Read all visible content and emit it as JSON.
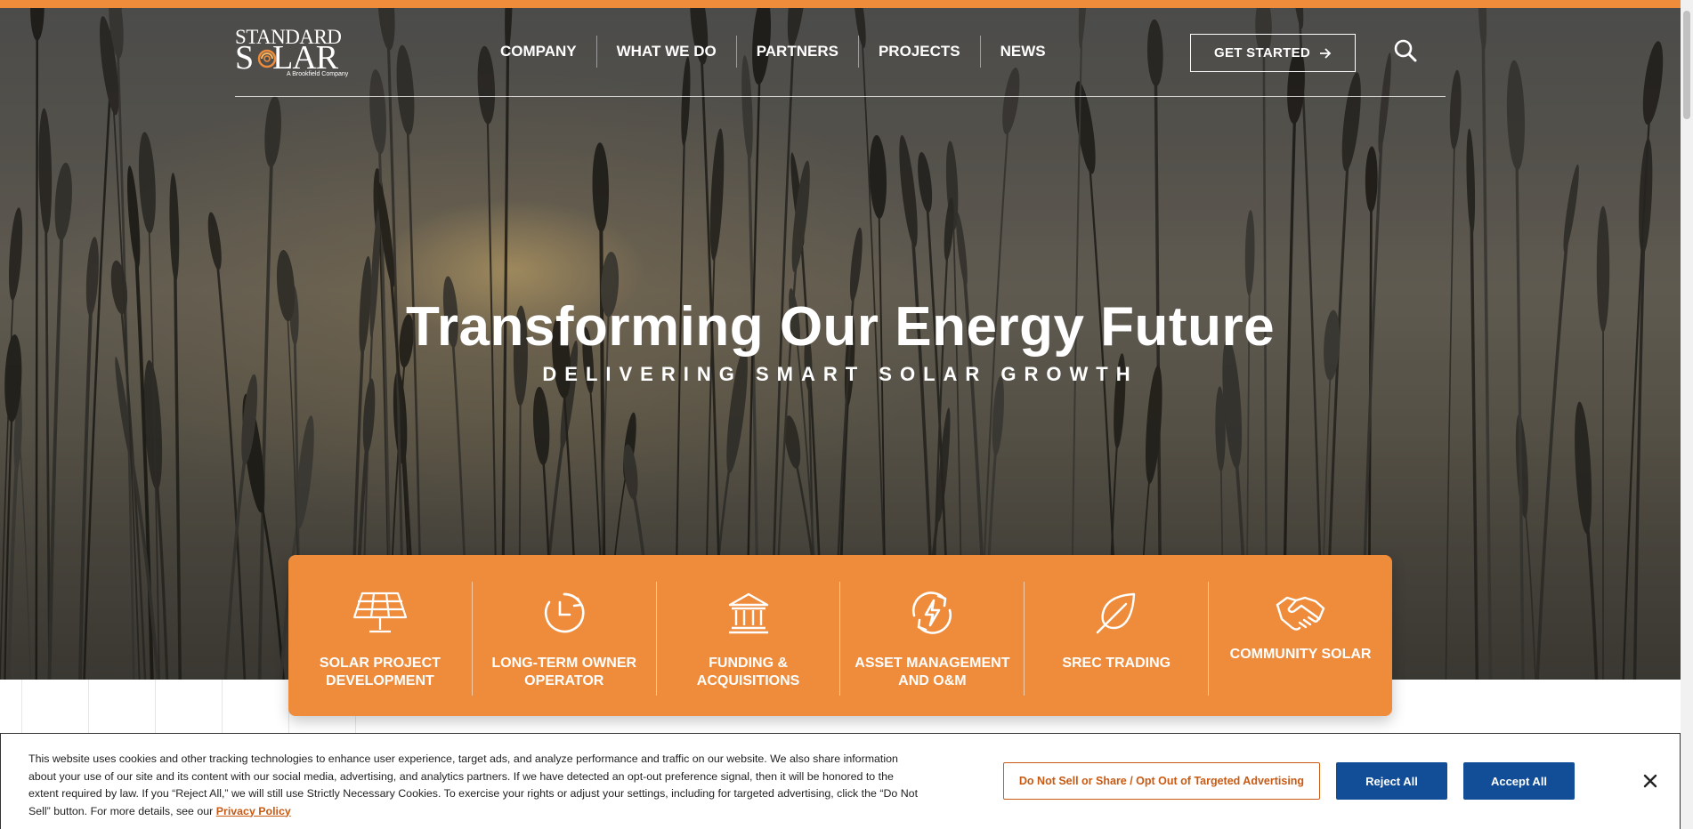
{
  "brand": {
    "logo_top": "STANDARD",
    "logo_main_s": "S",
    "logo_main_rest": "LAR",
    "logo_sub": "A Brookfield Company",
    "accent": "#ef8c3c",
    "button_blue": "#114e97",
    "link_orange": "#c85a13"
  },
  "nav": {
    "items": [
      {
        "label": "COMPANY"
      },
      {
        "label": "WHAT WE DO"
      },
      {
        "label": "PARTNERS"
      },
      {
        "label": "PROJECTS"
      },
      {
        "label": "NEWS"
      }
    ],
    "cta_label": "GET STARTED",
    "cta_icon": "arrow-right-icon",
    "search_icon": "search-icon"
  },
  "hero": {
    "title": "Transforming Our Energy Future",
    "subtitle": "DELIVERING SMART SOLAR GROWTH"
  },
  "services": [
    {
      "label": "SOLAR PROJECT DEVELOPMENT",
      "icon": "solar-panel-icon"
    },
    {
      "label": "LONG-TERM OWNER OPERATOR",
      "icon": "clock-cycle-icon"
    },
    {
      "label": "FUNDING & ACQUISITIONS",
      "icon": "bank-icon"
    },
    {
      "label": "ASSET MANAGEMENT AND O&M",
      "icon": "energy-cycle-icon"
    },
    {
      "label": "SREC TRADING",
      "icon": "leaf-icon"
    },
    {
      "label": "COMMUNITY SOLAR",
      "icon": "handshake-icon"
    }
  ],
  "cookie": {
    "text": "This website uses cookies and other tracking technologies to enhance user experience, target ads, and analyze performance and traffic on our website. We also share information about your use of our site and its content with our social media, advertising, and analytics partners. If we have detected an opt-out preference signal, then it will be honored to the extent required by law. If you “Reject All,” we will still use Strictly Necessary Cookies. To exercise your rights or adjust your settings, including for targeted advertising, click the “Do Not Sell” button. For more details, see our",
    "link_label": "Privacy Policy",
    "optout_label": "Do Not Sell or Share / Opt Out of Targeted Advertising",
    "reject_label": "Reject All",
    "accept_label": "Accept All",
    "close_icon": "close-icon"
  }
}
